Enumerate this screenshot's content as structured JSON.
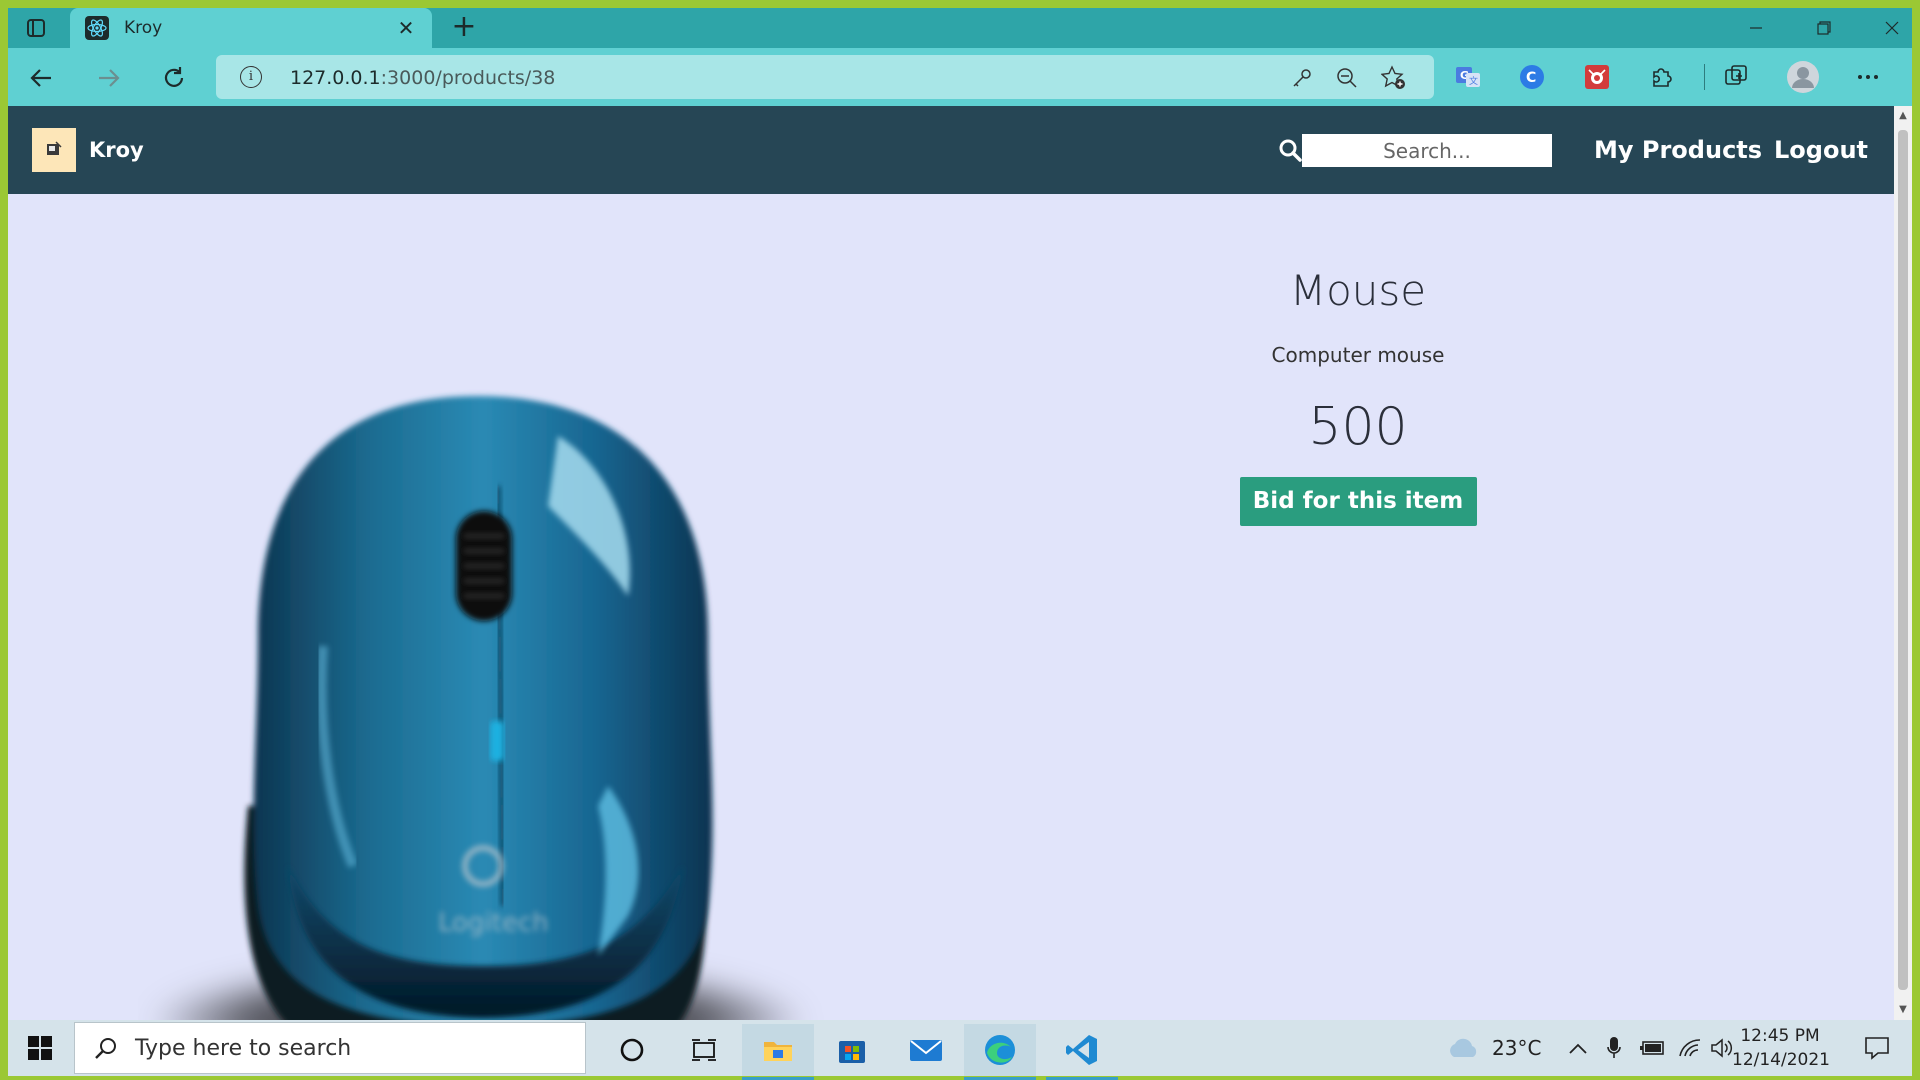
{
  "browser": {
    "tab_title": "Kroy",
    "url_host": "127.0.0.1",
    "url_path": ":3000/products/38",
    "close_tab_glyph": "✕",
    "new_tab_glyph": "+"
  },
  "app": {
    "brand_name": "Kroy",
    "search_placeholder": "Search...",
    "nav_links": [
      "My Products",
      "Logout"
    ]
  },
  "product": {
    "title": "Mouse",
    "description": "Computer mouse",
    "price": "500",
    "bid_button_label": "Bid for this item",
    "image_brand_text": "Logitech"
  },
  "taskbar": {
    "search_placeholder": "Type here to search",
    "weather_temp": "23°C",
    "time": "12:45 PM",
    "date": "12/14/2021"
  },
  "colors": {
    "app_nav_bg": "#264655",
    "page_bg": "#e1e4fa",
    "bid_button_bg": "#2a9d7f",
    "browser_frame": "#5fd0d2"
  }
}
